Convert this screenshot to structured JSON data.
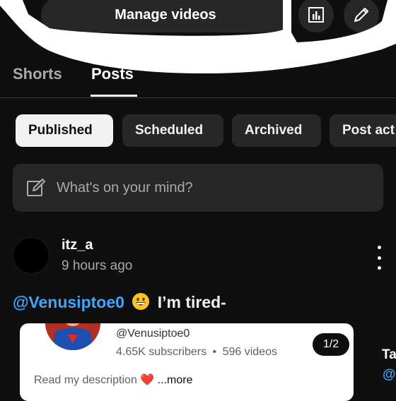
{
  "header": {
    "manage_label": "Manage videos",
    "analytics_icon": "analytics-icon",
    "edit_icon": "pencil-icon"
  },
  "tabs": [
    {
      "label": "Shorts",
      "active": false
    },
    {
      "label": "Posts",
      "active": true
    }
  ],
  "chips": [
    {
      "label": "Published",
      "selected": true
    },
    {
      "label": "Scheduled",
      "selected": false
    },
    {
      "label": "Archived",
      "selected": false
    },
    {
      "label": "Post act",
      "selected": false
    }
  ],
  "composer": {
    "placeholder": "What's on your mind?",
    "icon": "edit-icon"
  },
  "post": {
    "author": "itz_a",
    "time": "9 hours ago",
    "mention": "@Venusiptoe0",
    "emoji": "grinning-face",
    "text": "I’m tired-",
    "card": {
      "handle": "@Venusiptoe0",
      "subscribers": "4.65K subscribers",
      "separator": "•",
      "videos": "596 videos",
      "description": "Read my description",
      "heart": "❤️",
      "more": "...more"
    },
    "pager": "1/2"
  },
  "peek": {
    "text1": "Ta",
    "text2": "@"
  },
  "colors": {
    "background": "#0f0f0f",
    "surface": "#272727",
    "link": "#3ea6ff"
  }
}
